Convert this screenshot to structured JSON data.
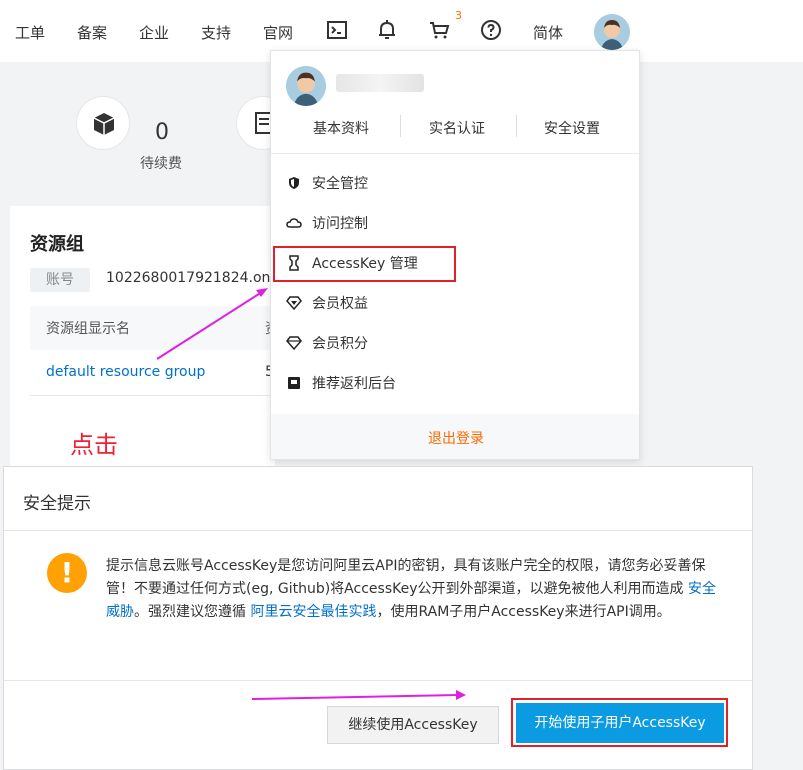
{
  "topnav": {
    "items": [
      "工单",
      "备案",
      "企业",
      "支持",
      "官网"
    ],
    "icons": [
      "terminal-icon",
      "bell-icon",
      "cart-icon",
      "help-icon"
    ],
    "cart_count": "3",
    "language": "简体"
  },
  "stats": {
    "value": "0",
    "label": "待续费"
  },
  "resource_card": {
    "title": "资源组",
    "account_tag": "账号",
    "account_value": "1022680017921824.onaliy",
    "col1": "资源组显示名",
    "col2": "资",
    "row_name": "default resource group",
    "row_val": "5"
  },
  "annotation": {
    "click_text": "点击"
  },
  "dropdown": {
    "tabs": [
      "基本资料",
      "实名认证",
      "安全设置"
    ],
    "items": [
      {
        "label": "安全管控",
        "icon": "shield-icon"
      },
      {
        "label": "访问控制",
        "icon": "cloud-icon"
      },
      {
        "label": "AccessKey 管理",
        "icon": "key-icon"
      },
      {
        "label": "会员权益",
        "icon": "diamond-icon"
      },
      {
        "label": "会员积分",
        "icon": "diamond-outline-icon"
      },
      {
        "label": "推荐返利后台",
        "icon": "card-icon"
      }
    ],
    "logout": "退出登录"
  },
  "modal": {
    "title": "安全提示",
    "text_part1": "提示信息云账号AccessKey是您访问阿里云API的密钥，具有该账户完全的权限，请您务必妥善保管！不要通过任何方式(eg, Github)将AccessKey公开到外部渠道，以避免被他人利用而造成 ",
    "link1": "安全威胁",
    "text_part2": "。强烈建议您遵循 ",
    "link2": "阿里云安全最佳实践",
    "text_part3": "，使用RAM子用户AccessKey来进行API调用。",
    "btn_continue": "继续使用AccessKey",
    "btn_start": "开始使用子用户AccessKey"
  },
  "colors": {
    "accent": "#ff6a00",
    "primary": "#0a9be3",
    "link": "#0070cc",
    "highlight": "#e0202a",
    "warning": "#ffa003",
    "arrow": "#e020e0"
  }
}
